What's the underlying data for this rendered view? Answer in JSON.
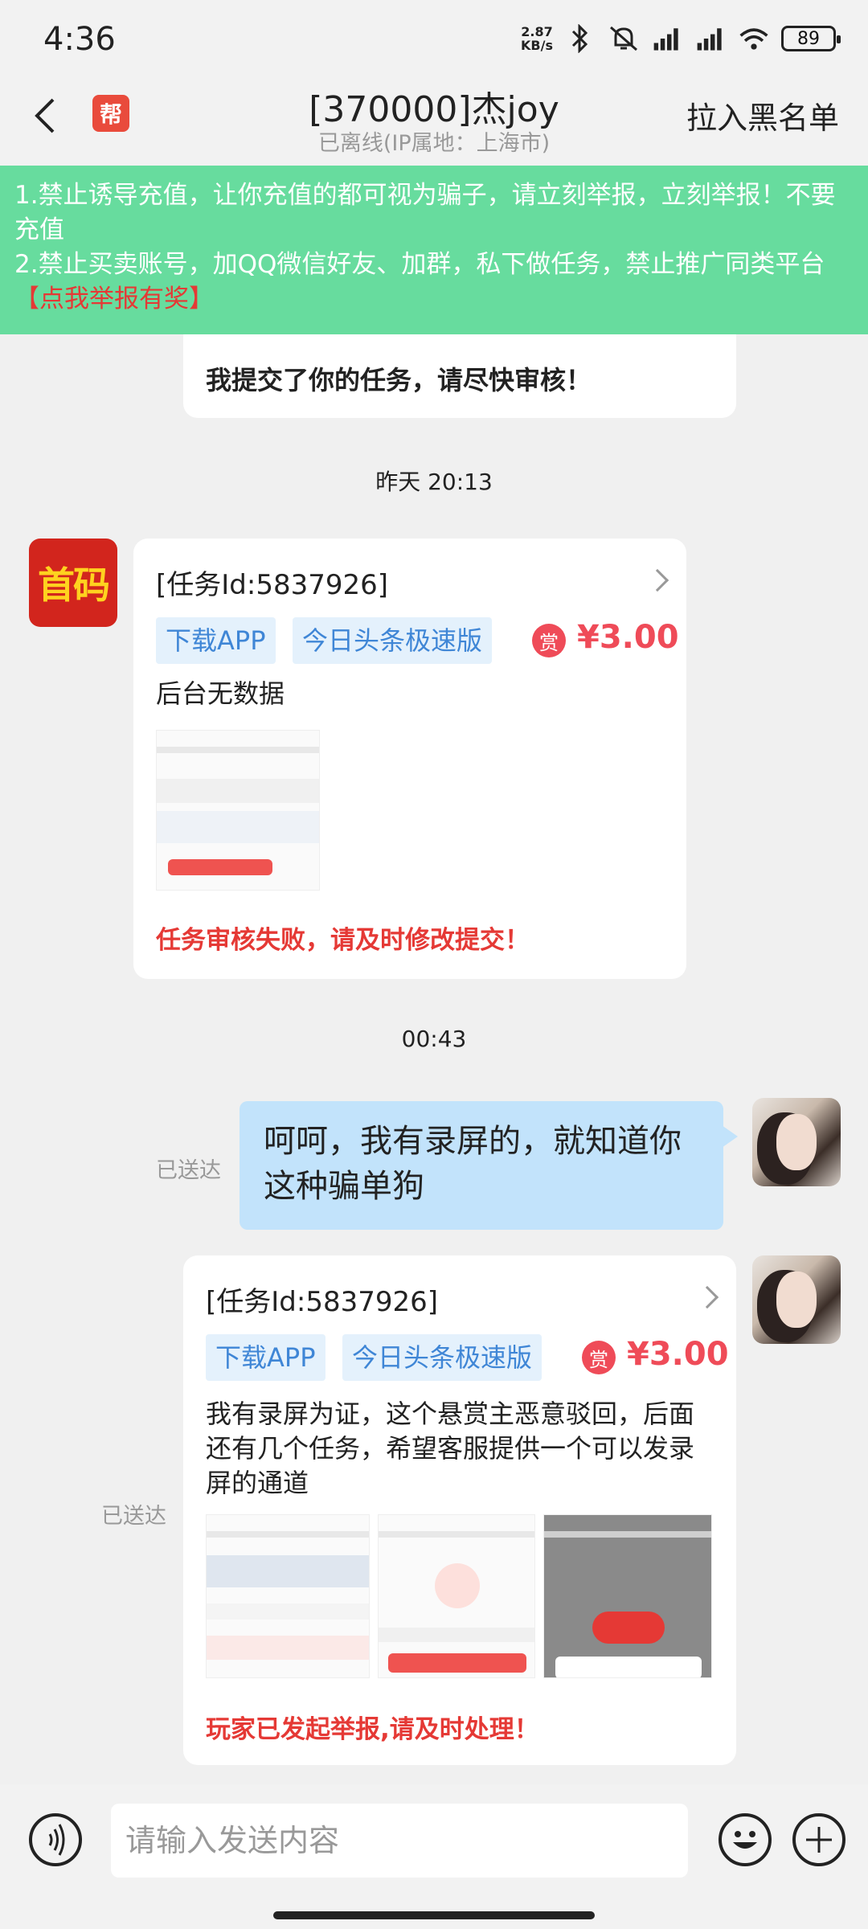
{
  "status": {
    "time": "4:36",
    "speed_value": "2.87",
    "speed_unit": "KB/s",
    "battery": "89"
  },
  "header": {
    "app_logo": "帮",
    "title": "[370000]杰joy",
    "subtitle": "已离线(IP属地：上海市)",
    "blacklist": "拉入黑名单"
  },
  "notice": {
    "line1": "1.禁止诱导充值，让你充值的都可视为骗子，请立刻举报，立刻举报！不要充值",
    "line2": "2.禁止买卖账号，加QQ微信好友、加群，私下做任务，禁止推广同类平台",
    "link": "【点我举报有奖】"
  },
  "messages": {
    "partial_text": "我提交了你的任务，请尽快审核！",
    "time1": "昨天 20:13",
    "card1": {
      "avatar": "首码",
      "task_id": "[任务Id:5837926]",
      "tag1": "下载APP",
      "tag2": "今日头条极速版",
      "reward_badge": "赏",
      "reward": "¥3.00",
      "text": "后台无数据",
      "alert": "任务审核失败，请及时修改提交！"
    },
    "time2": "00:43",
    "my_msg": {
      "status": "已送达",
      "text": "呵呵，我有录屏的，就知道你这种骗单狗"
    },
    "card2": {
      "status": "已送达",
      "task_id": "[任务Id:5837926]",
      "tag1": "下载APP",
      "tag2": "今日头条极速版",
      "reward_badge": "赏",
      "reward": "¥3.00",
      "text": "我有录屏为证，这个悬赏主恶意驳回，后面还有几个任务，希望客服提供一个可以发录屏的通道",
      "alert": "玩家已发起举报,请及时处理！"
    }
  },
  "input": {
    "placeholder": "请输入发送内容"
  },
  "colors": {
    "notice_bg": "#67dc9e",
    "alert_red": "#e53935",
    "reward_red": "#ef4b58",
    "tag_blue": "#3f86d6",
    "my_bubble": "#c2e3fb"
  }
}
